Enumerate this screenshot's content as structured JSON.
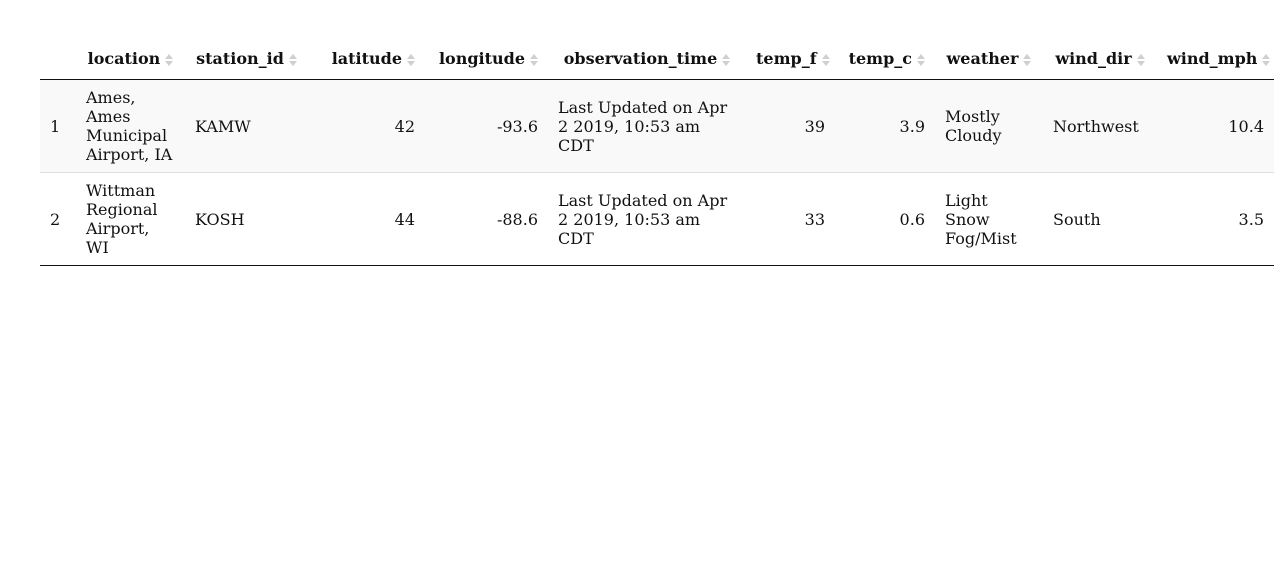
{
  "table": {
    "columns": [
      {
        "key": "idx",
        "label": ""
      },
      {
        "key": "location",
        "label": "location"
      },
      {
        "key": "station_id",
        "label": "station_id"
      },
      {
        "key": "latitude",
        "label": "latitude"
      },
      {
        "key": "longitude",
        "label": "longitude"
      },
      {
        "key": "observation_time",
        "label": "observation_time"
      },
      {
        "key": "temp_f",
        "label": "temp_f"
      },
      {
        "key": "temp_c",
        "label": "temp_c"
      },
      {
        "key": "weather",
        "label": "weather"
      },
      {
        "key": "wind_dir",
        "label": "wind_dir"
      },
      {
        "key": "wind_mph",
        "label": "wind_mph"
      }
    ],
    "rows": [
      {
        "idx": "1",
        "location": "Ames, Ames Municipal Airport, IA",
        "station_id": "KAMW",
        "latitude": "42",
        "longitude": "-93.6",
        "observation_time": "Last Updated on Apr 2 2019, 10:53 am CDT",
        "temp_f": "39",
        "temp_c": "3.9",
        "weather": "Mostly Cloudy",
        "wind_dir": "Northwest",
        "wind_mph": "10.4"
      },
      {
        "idx": "2",
        "location": "Wittman Regional Airport, WI",
        "station_id": "KOSH",
        "latitude": "44",
        "longitude": "-88.6",
        "observation_time": "Last Updated on Apr 2 2019, 10:53 am CDT",
        "temp_f": "33",
        "temp_c": "0.6",
        "weather": "Light Snow Fog/Mist",
        "wind_dir": "South",
        "wind_mph": "3.5"
      }
    ]
  }
}
